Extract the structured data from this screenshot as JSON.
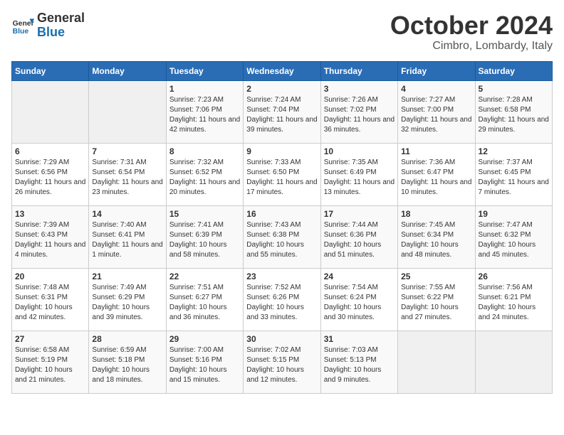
{
  "header": {
    "logo_general": "General",
    "logo_blue": "Blue",
    "month": "October 2024",
    "location": "Cimbro, Lombardy, Italy"
  },
  "weekdays": [
    "Sunday",
    "Monday",
    "Tuesday",
    "Wednesday",
    "Thursday",
    "Friday",
    "Saturday"
  ],
  "weeks": [
    [
      {
        "day": "",
        "info": ""
      },
      {
        "day": "",
        "info": ""
      },
      {
        "day": "1",
        "info": "Sunrise: 7:23 AM\nSunset: 7:06 PM\nDaylight: 11 hours and 42 minutes."
      },
      {
        "day": "2",
        "info": "Sunrise: 7:24 AM\nSunset: 7:04 PM\nDaylight: 11 hours and 39 minutes."
      },
      {
        "day": "3",
        "info": "Sunrise: 7:26 AM\nSunset: 7:02 PM\nDaylight: 11 hours and 36 minutes."
      },
      {
        "day": "4",
        "info": "Sunrise: 7:27 AM\nSunset: 7:00 PM\nDaylight: 11 hours and 32 minutes."
      },
      {
        "day": "5",
        "info": "Sunrise: 7:28 AM\nSunset: 6:58 PM\nDaylight: 11 hours and 29 minutes."
      }
    ],
    [
      {
        "day": "6",
        "info": "Sunrise: 7:29 AM\nSunset: 6:56 PM\nDaylight: 11 hours and 26 minutes."
      },
      {
        "day": "7",
        "info": "Sunrise: 7:31 AM\nSunset: 6:54 PM\nDaylight: 11 hours and 23 minutes."
      },
      {
        "day": "8",
        "info": "Sunrise: 7:32 AM\nSunset: 6:52 PM\nDaylight: 11 hours and 20 minutes."
      },
      {
        "day": "9",
        "info": "Sunrise: 7:33 AM\nSunset: 6:50 PM\nDaylight: 11 hours and 17 minutes."
      },
      {
        "day": "10",
        "info": "Sunrise: 7:35 AM\nSunset: 6:49 PM\nDaylight: 11 hours and 13 minutes."
      },
      {
        "day": "11",
        "info": "Sunrise: 7:36 AM\nSunset: 6:47 PM\nDaylight: 11 hours and 10 minutes."
      },
      {
        "day": "12",
        "info": "Sunrise: 7:37 AM\nSunset: 6:45 PM\nDaylight: 11 hours and 7 minutes."
      }
    ],
    [
      {
        "day": "13",
        "info": "Sunrise: 7:39 AM\nSunset: 6:43 PM\nDaylight: 11 hours and 4 minutes."
      },
      {
        "day": "14",
        "info": "Sunrise: 7:40 AM\nSunset: 6:41 PM\nDaylight: 11 hours and 1 minute."
      },
      {
        "day": "15",
        "info": "Sunrise: 7:41 AM\nSunset: 6:39 PM\nDaylight: 10 hours and 58 minutes."
      },
      {
        "day": "16",
        "info": "Sunrise: 7:43 AM\nSunset: 6:38 PM\nDaylight: 10 hours and 55 minutes."
      },
      {
        "day": "17",
        "info": "Sunrise: 7:44 AM\nSunset: 6:36 PM\nDaylight: 10 hours and 51 minutes."
      },
      {
        "day": "18",
        "info": "Sunrise: 7:45 AM\nSunset: 6:34 PM\nDaylight: 10 hours and 48 minutes."
      },
      {
        "day": "19",
        "info": "Sunrise: 7:47 AM\nSunset: 6:32 PM\nDaylight: 10 hours and 45 minutes."
      }
    ],
    [
      {
        "day": "20",
        "info": "Sunrise: 7:48 AM\nSunset: 6:31 PM\nDaylight: 10 hours and 42 minutes."
      },
      {
        "day": "21",
        "info": "Sunrise: 7:49 AM\nSunset: 6:29 PM\nDaylight: 10 hours and 39 minutes."
      },
      {
        "day": "22",
        "info": "Sunrise: 7:51 AM\nSunset: 6:27 PM\nDaylight: 10 hours and 36 minutes."
      },
      {
        "day": "23",
        "info": "Sunrise: 7:52 AM\nSunset: 6:26 PM\nDaylight: 10 hours and 33 minutes."
      },
      {
        "day": "24",
        "info": "Sunrise: 7:54 AM\nSunset: 6:24 PM\nDaylight: 10 hours and 30 minutes."
      },
      {
        "day": "25",
        "info": "Sunrise: 7:55 AM\nSunset: 6:22 PM\nDaylight: 10 hours and 27 minutes."
      },
      {
        "day": "26",
        "info": "Sunrise: 7:56 AM\nSunset: 6:21 PM\nDaylight: 10 hours and 24 minutes."
      }
    ],
    [
      {
        "day": "27",
        "info": "Sunrise: 6:58 AM\nSunset: 5:19 PM\nDaylight: 10 hours and 21 minutes."
      },
      {
        "day": "28",
        "info": "Sunrise: 6:59 AM\nSunset: 5:18 PM\nDaylight: 10 hours and 18 minutes."
      },
      {
        "day": "29",
        "info": "Sunrise: 7:00 AM\nSunset: 5:16 PM\nDaylight: 10 hours and 15 minutes."
      },
      {
        "day": "30",
        "info": "Sunrise: 7:02 AM\nSunset: 5:15 PM\nDaylight: 10 hours and 12 minutes."
      },
      {
        "day": "31",
        "info": "Sunrise: 7:03 AM\nSunset: 5:13 PM\nDaylight: 10 hours and 9 minutes."
      },
      {
        "day": "",
        "info": ""
      },
      {
        "day": "",
        "info": ""
      }
    ]
  ]
}
